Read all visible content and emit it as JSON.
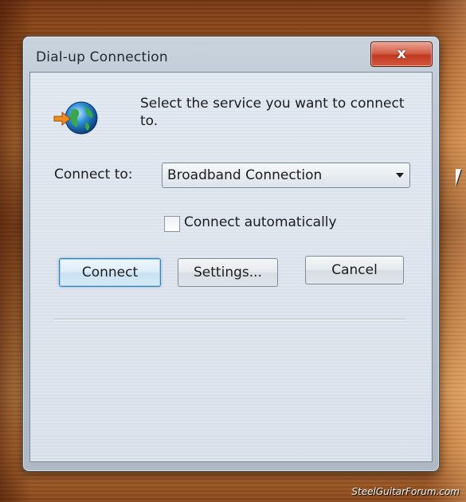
{
  "window": {
    "title": "Dial-up Connection",
    "close_glyph": "x"
  },
  "dialog": {
    "prompt": "Select the service you want to connect to.",
    "connect_to_label": "Connect to:",
    "connection_value": "Broadband Connection",
    "auto_connect_label": "Connect automatically",
    "auto_connect_checked": false
  },
  "buttons": {
    "connect": "Connect",
    "settings": "Settings...",
    "cancel": "Cancel"
  },
  "watermark": "SteelGuitarForum.com",
  "icons": {
    "window_icon": "globe-connection-icon",
    "dropdown": "chevron-down-icon",
    "close": "close-icon"
  },
  "colors": {
    "close_button": "#c13a22",
    "default_button_border": "#3c7fb1",
    "desktop": "#a85a22"
  }
}
